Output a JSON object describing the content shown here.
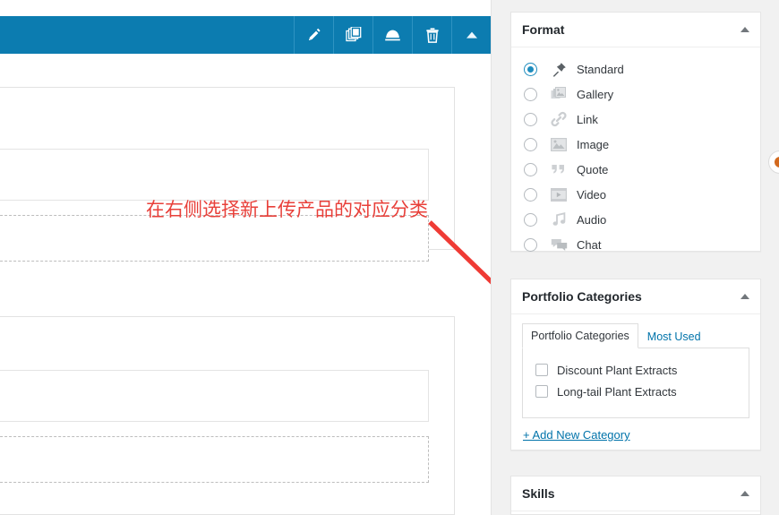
{
  "annotation": {
    "text": "在右侧选择新上传产品的对应分类",
    "color": "#e8403a",
    "arrow_name": "red-arrow-pointing-to-portfolio-categories"
  },
  "toolbar": {
    "background": "#0c7cb0",
    "buttons": [
      {
        "name": "edit-module-button",
        "icon": "pencil-icon",
        "label": "Edit"
      },
      {
        "name": "duplicate-module-button",
        "icon": "duplicate-icon",
        "label": "Duplicate"
      },
      {
        "name": "save-module-button",
        "icon": "save-icon",
        "label": "Save"
      },
      {
        "name": "delete-module-button",
        "icon": "trash-icon",
        "label": "Delete"
      },
      {
        "name": "collapse-module-button",
        "icon": "triangle-up-icon",
        "label": "Collapse"
      }
    ]
  },
  "sidebar": {
    "format_panel": {
      "title": "Format",
      "collapse_icon": "triangle-up-icon",
      "selected": "Standard",
      "options": [
        {
          "label": "Standard",
          "icon": "pushpin-icon",
          "checked": true
        },
        {
          "label": "Gallery",
          "icon": "gallery-icon",
          "checked": false
        },
        {
          "label": "Link",
          "icon": "link-icon",
          "checked": false
        },
        {
          "label": "Image",
          "icon": "image-icon",
          "checked": false
        },
        {
          "label": "Quote",
          "icon": "quote-icon",
          "checked": false
        },
        {
          "label": "Video",
          "icon": "video-icon",
          "checked": false
        },
        {
          "label": "Audio",
          "icon": "audio-icon",
          "checked": false
        },
        {
          "label": "Chat",
          "icon": "chat-icon",
          "checked": false
        }
      ]
    },
    "categories_panel": {
      "title": "Portfolio Categories",
      "collapse_icon": "triangle-up-icon",
      "tabs": [
        {
          "label": "Portfolio Categories",
          "active": true
        },
        {
          "label": "Most Used",
          "active": false
        }
      ],
      "items": [
        {
          "label": "Discount Plant Extracts",
          "checked": false
        },
        {
          "label": "Long-tail Plant Extracts",
          "checked": false
        }
      ],
      "add_link": "+ Add New Category"
    },
    "skills_panel": {
      "title": "Skills",
      "collapse_icon": "triangle-up-icon"
    }
  },
  "accent_colors": {
    "toolbar_blue": "#0c7cb0",
    "radio_blue": "#1e8cbe",
    "link_blue": "#0073aa",
    "annotation_red": "#e8403a"
  }
}
